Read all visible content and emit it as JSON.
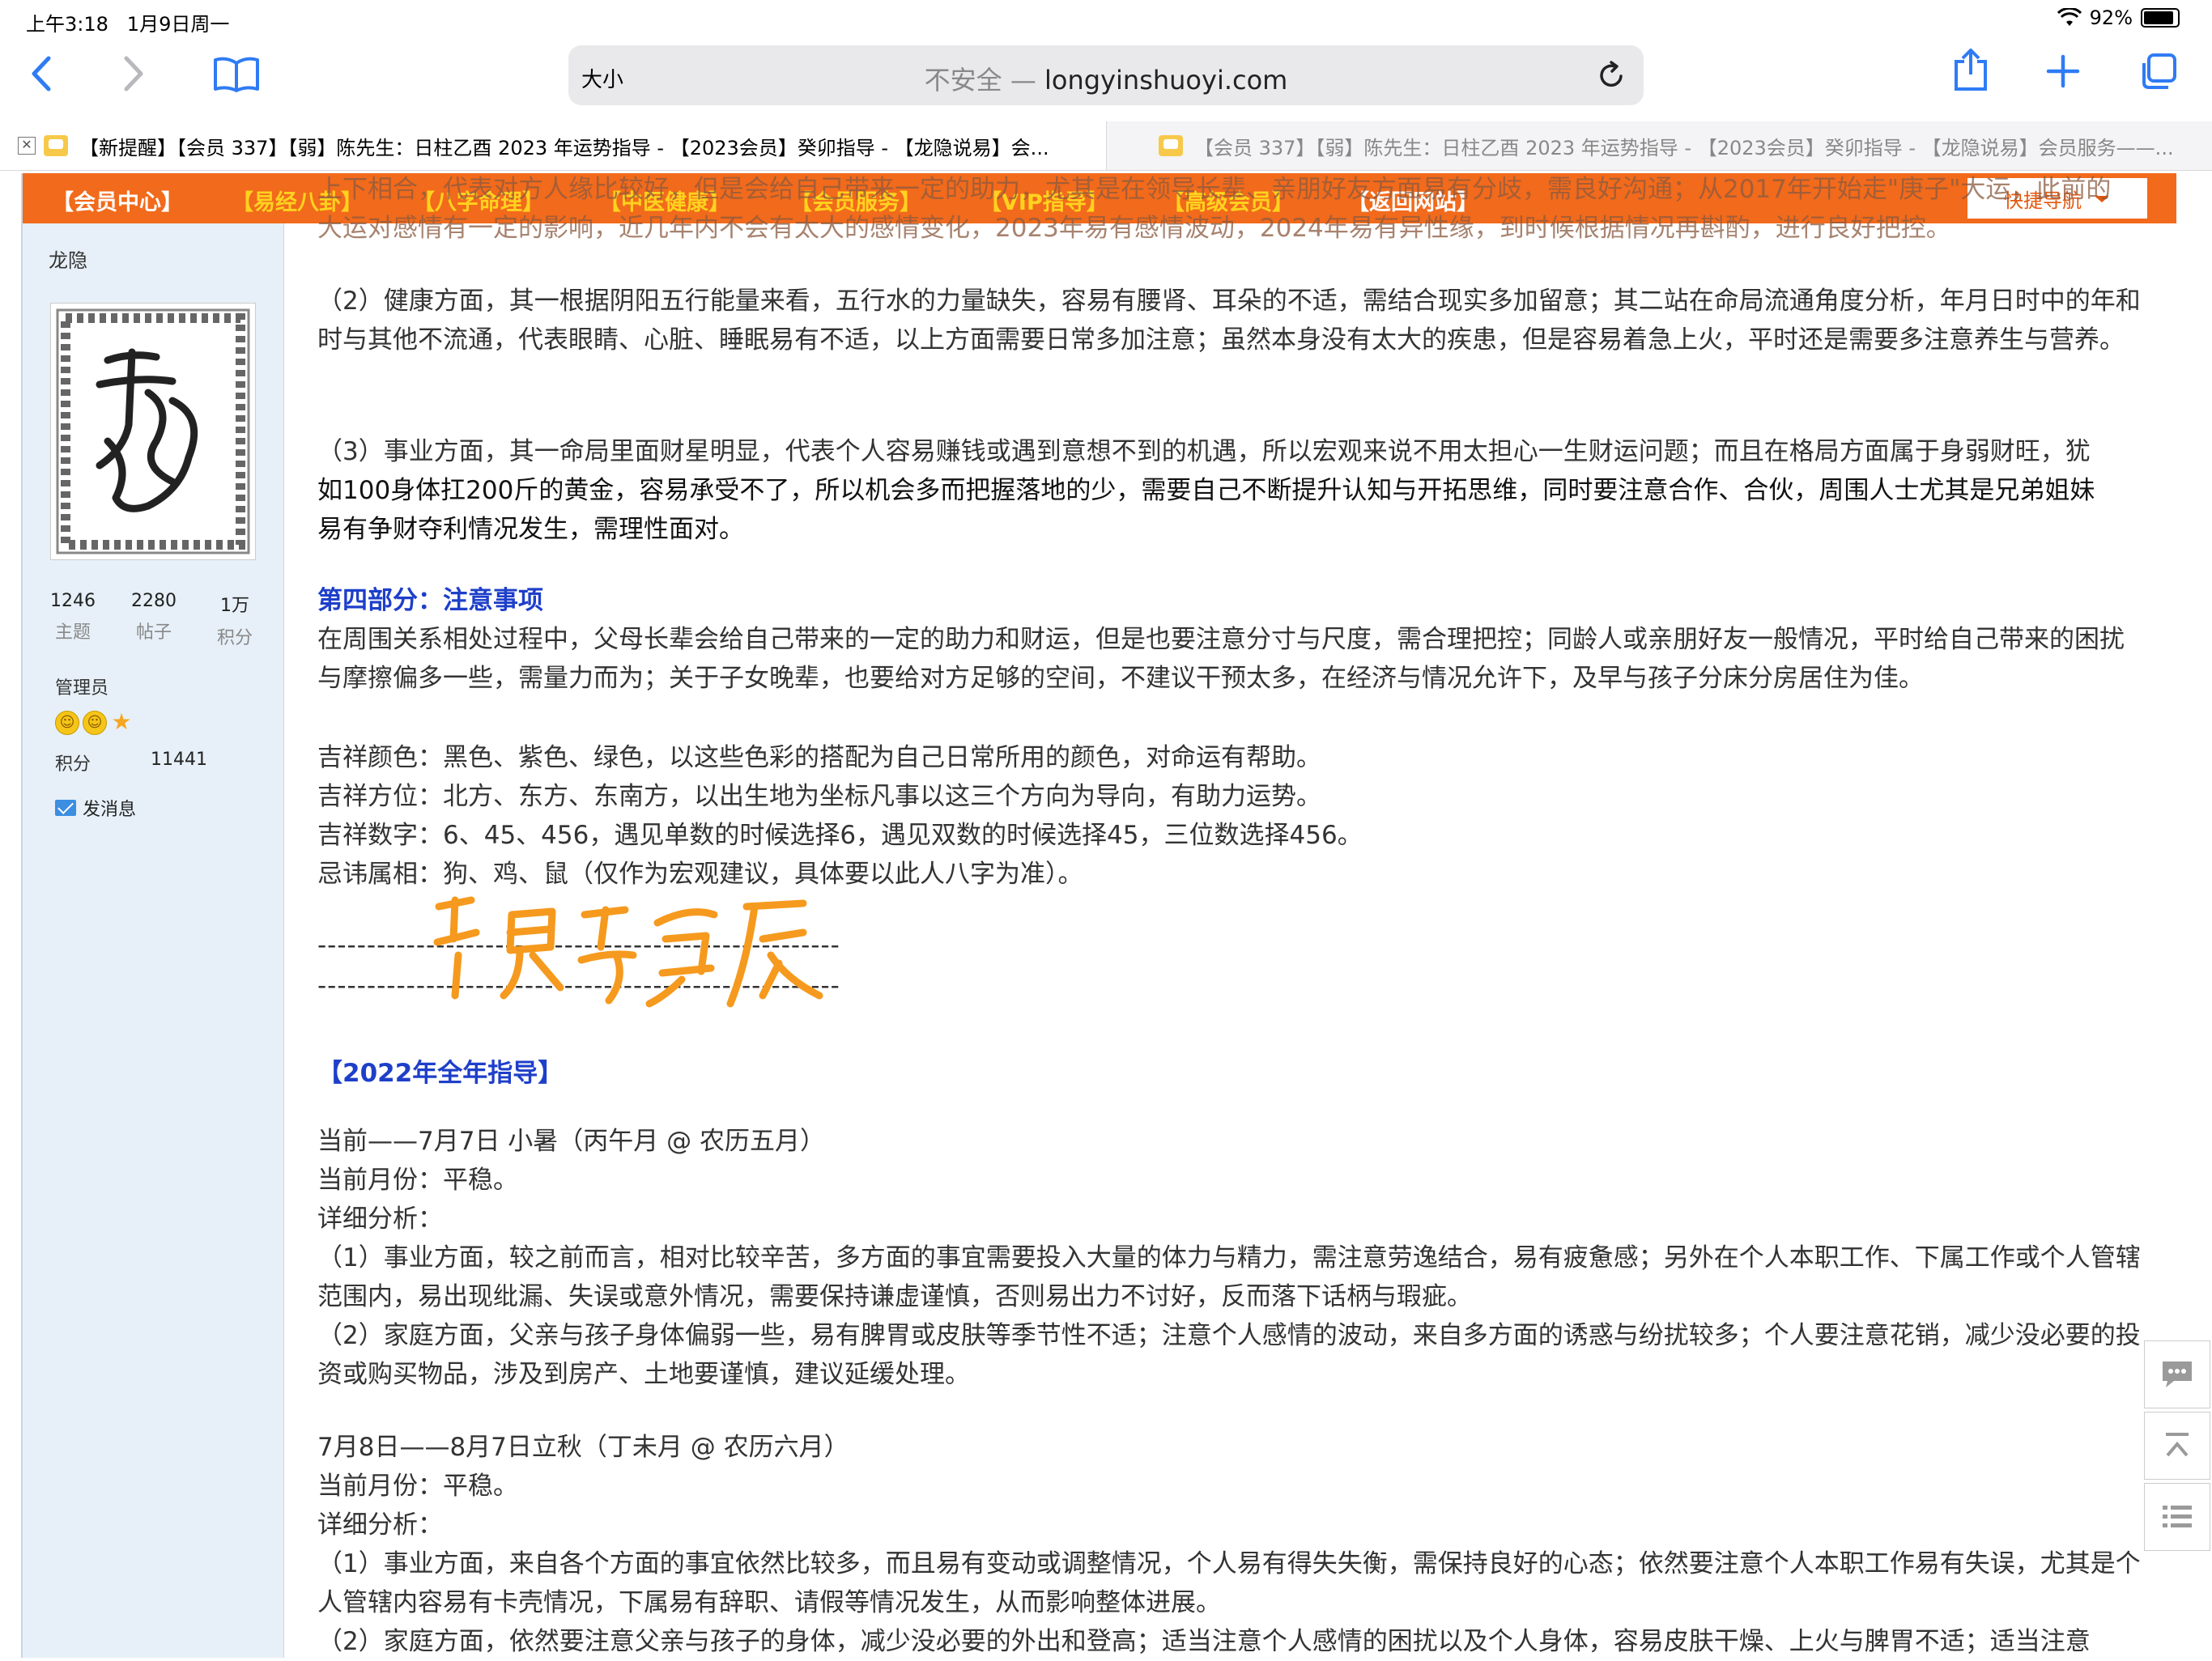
{
  "status": {
    "time": "上午3:18",
    "date": "1月9日周一",
    "battery": "92%"
  },
  "browser": {
    "aa_label": "大小",
    "insecure_label": "不安全 —",
    "domain": "longyinshuoyi.com"
  },
  "tabs": [
    {
      "title": "【新提醒】【会员 337】【弱】陈先生：日柱乙酉 2023 年运势指导 - 【2023会员】癸卯指导 - 【龙隐说易】会..."
    },
    {
      "title": "【会员 337】【弱】陈先生：日柱乙酉 2023 年运势指导 - 【2023会员】癸卯指导 - 【龙隐说易】会员服务——..."
    }
  ],
  "nav": {
    "items": [
      "【会员中心】",
      "【易经八卦】",
      "【八字命理】",
      "【中医健康】",
      "【会员服务】",
      "【VIP指导】",
      "【高级会员】",
      "【返回网站】"
    ],
    "quick_nav": "快捷导航"
  },
  "user": {
    "name": "龙隐",
    "avatar_seal_text": "龍隱說易",
    "stats": [
      {
        "num": "1246",
        "label": "主题"
      },
      {
        "num": "2280",
        "label": "帖子"
      },
      {
        "num": "1万",
        "label": "积分"
      }
    ],
    "role": "管理员",
    "points_label": "积分",
    "points_value": "11441",
    "send_message": "发消息"
  },
  "post": {
    "overlap_1": "上下相合，代表对方人缘比较好，但是会给自己带来一定的助力，尤其是在领导长辈、亲朋好友方面易有分歧，需良好沟通；从2017年开始走\"庚子\"大运，此前的",
    "overlap_2": "大运对感情有一定的影响，近几年内不会有太大的感情变化，2023年易有感情波动，2024年易有异性缘，到时候根据情况再斟酌，进行良好把控。",
    "health": "（2）健康方面，其一根据阴阳五行能量来看，五行水的力量缺失，容易有腰肾、耳朵的不适，需结合现实多加留意；其二站在命局流通角度分析，年月日时中的年和时与其他不流通，代表眼睛、心脏、睡眠易有不适，以上方面需要日常多加注意；虽然本身没有太大的疾患，但是容易着急上火，平时还是需要多注意养生与营养。",
    "career_a": "（3）事业方面，其一命局里面财星明显，代表个人容易赚钱或遇到意想不到的机遇，所以宏观来说不用太担心一生财运问题；而且在格局方面属于身弱财旺，犹",
    "career_b": "如100身体扛200斤的黄金，容易承受不了，所以机会多而把握落地的少，需要自己不断提升认知与开拓思维，同时要注意合作、合伙，周围人士尤其是兄弟姐妹",
    "career_c": "易有争财夺利情况发生，需理性面对。",
    "part4_title": "第四部分：注意事项",
    "part4": "在周围关系相处过程中，父母长辈会给自己带来的一定的助力和财运，但是也要注意分寸与尺度，需合理把控；同龄人或亲朋好友一般情况，平时给自己带来的困扰与摩擦偏多一些，需量力而为；关于子女晚辈，也要给对方足够的空间，不建议干预太多，在经济与情况允许下，及早与孩子分床分房居住为佳。",
    "colors": "吉祥颜色：黑色、紫色、绿色，以这些色彩的搭配为自己日常所用的颜色，对命运有帮助。",
    "directions": "吉祥方位：北方、东方、东南方，以出生地为坐标凡事以这三个方向为导向，有助力运势。",
    "numbers": "吉祥数字：6、45、456，遇见单数的时候选择6，遇见双数的时候选择45，三位数选择456。",
    "avoid": "忌讳属相：狗、鸡、鼠（仅作为宏观建议，具体要以此人八字为准）。",
    "dashes": "-----------------------------------------------------",
    "handwriting": "已是不是辰",
    "year_title": "【2022年全年指导】",
    "m1_head": "当前——7月7日 小暑（丙午月 @ 农历五月）",
    "m1_month": "当前月份：平稳。",
    "detail_label": "详细分析：",
    "m1_career": "（1）事业方面，较之前而言，相对比较辛苦，多方面的事宜需要投入大量的体力与精力，需注意劳逸结合，易有疲惫感；另外在个人本职工作、下属工作或个人管辖范围内，易出现纰漏、失误或意外情况，需要保持谦虚谨慎，否则易出力不讨好，反而落下话柄与瑕疵。",
    "m1_family": "（2）家庭方面，父亲与孩子身体偏弱一些，易有脾胃或皮肤等季节性不适；注意个人感情的波动，来自多方面的诱惑与纷扰较多；个人要注意花销，减少没必要的投资或购买物品，涉及到房产、土地要谨慎，建议延缓处理。",
    "m2_head": "7月8日——8月7日立秋（丁未月 @ 农历六月）",
    "m2_month": "当前月份：平稳。",
    "m2_career": "（1）事业方面，来自各个方面的事宜依然比较多，而且易有变动或调整情况，个人易有得失失衡，需保持良好的心态；依然要注意个人本职工作易有失误，尤其是个人管辖内容易有卡壳情况，下属易有辞职、请假等情况发生，从而影响整体进展。",
    "m2_family": "（2）家庭方面，依然要注意父亲与孩子的身体，减少没必要的外出和登高；适当注意个人感情的困扰以及个人身体，容易皮肤干燥、上火与脾胃不适；适当注意"
  },
  "colors": {
    "accent": "#2f7bf5",
    "nav_bg": "#f26a1b",
    "nav_text": "#ffd21f",
    "heading_blue": "#1e3fc9",
    "sidebar_bg": "#e7f0f8",
    "handwriting": "#f59a1e"
  }
}
